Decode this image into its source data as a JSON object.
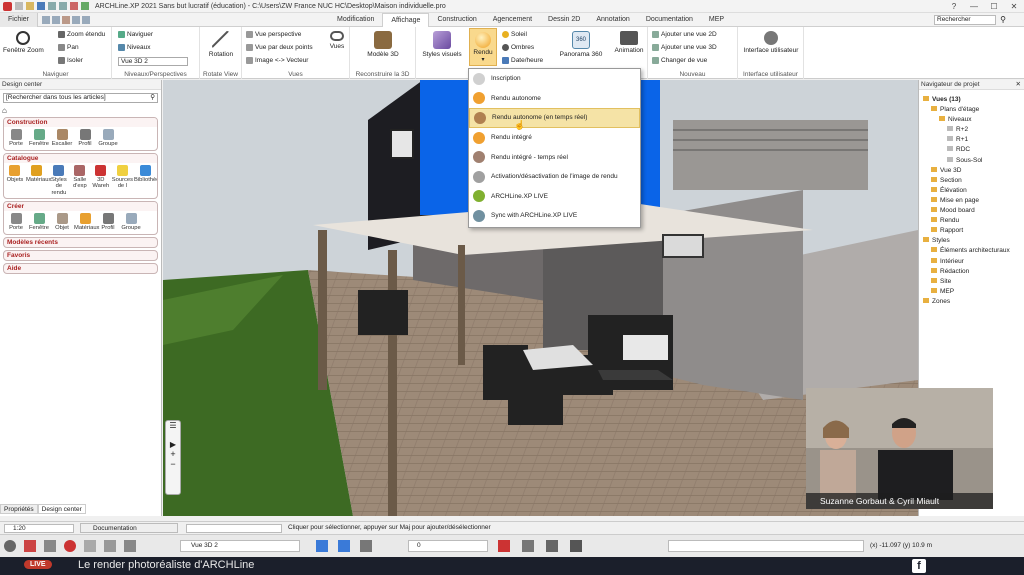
{
  "titlebar": {
    "title": "ARCHLine.XP 2021  Sans but lucratif (éducation) - C:\\Users\\ZW France NUC HC\\Desktop\\Maison individuelle.pro",
    "min": "—",
    "max": "☐",
    "close": "✕",
    "help": "?"
  },
  "tabs": [
    "Fichier",
    "Modification",
    "Affichage",
    "Construction",
    "Agencement",
    "Dessin 2D",
    "Annotation",
    "Documentation",
    "MEP"
  ],
  "search_placeholder": "Rechercher",
  "ribbon": {
    "fenetre_zoom": "Fenêtre Zoom",
    "zoom_etendu": "Zoom étendu",
    "pan": "Pan",
    "isoler": "Isoler",
    "naviguer_group": "Naviguer",
    "naviguer": "Naviguer",
    "niveaux": "Niveaux",
    "vue3d2": "Vue 3D 2",
    "niveaux_perspectives": "Niveaux/Perspectives",
    "rotation": "Rotation",
    "rotate_view": "Rotate View",
    "vue_perspective": "Vue perspective",
    "vue_deux_points": "Vue par deux points",
    "image_vecteur": "Image <-> Vecteur",
    "vues_btn": "Vues",
    "vues_group": "Vues",
    "modele3d": "Modèle 3D",
    "reconstruire": "Reconstruire la 3D",
    "styles_visuels": "Styles visuels",
    "rendu": "Rendu",
    "soleil": "Soleil",
    "ombres": "Ombres",
    "date_heure": "Date/heure",
    "panorama": "Panorama 360",
    "panorama_badge": "360",
    "animation": "Animation",
    "ajouter_3d": "Ajouter une vue 3D",
    "ajouter_2d": "Ajouter une vue 2D",
    "changer_vue": "Changer de vue",
    "nouveau": "Nouveau",
    "interface": "Interface utilisateur",
    "interface_group": "Interface utilisateur"
  },
  "rendu_menu": [
    {
      "label": "Inscription",
      "color": "#d0d0d0"
    },
    {
      "label": "Rendu autonome",
      "color": "#f0a030"
    },
    {
      "label": "Rendu autonome (en temps réel)",
      "color": "#b08050",
      "highlighted": true
    },
    {
      "label": "Rendu intégré",
      "color": "#f0a030"
    },
    {
      "label": "Rendu intégré - temps réel",
      "color": "#a08070"
    },
    {
      "label": "Activation/désactivation de l'image de rendu",
      "color": "#a0a0a0"
    },
    {
      "label": "ARCHLine.XP LIVE",
      "color": "#80b030"
    },
    {
      "label": "Sync with ARCHLine.XP LIVE",
      "color": "#7090a0"
    }
  ],
  "left": {
    "header": "Design center",
    "search": "[Rechercher dans tous les articles]",
    "construction": {
      "title": "Construction",
      "items": [
        "Porte",
        "Fenêtre",
        "Escalier",
        "Profil",
        "Groupe"
      ]
    },
    "catalogue": {
      "title": "Catalogue",
      "items": [
        "Objets",
        "Matériaux",
        "Styles de rendu",
        "Salle d'exp",
        "3D Wareh",
        "Sources de l",
        "Bibliothèque"
      ]
    },
    "creer": {
      "title": "Créer",
      "items": [
        "Porte",
        "Fenêtre",
        "Objet",
        "Matériaux",
        "Profil",
        "Groupe"
      ]
    },
    "collapsed": [
      "Modèles récents",
      "Favoris",
      "Aide"
    ],
    "tabs": [
      "Propriétés",
      "Design center"
    ]
  },
  "navigator": {
    "header": "Navigateur de projet",
    "tree": [
      {
        "label": "Vues (13)",
        "level": 0,
        "bold": true
      },
      {
        "label": "Plans d'étage",
        "level": 1
      },
      {
        "label": "Niveaux",
        "level": 2
      },
      {
        "label": "R+2",
        "level": 3
      },
      {
        "label": "R+1",
        "level": 3
      },
      {
        "label": "RDC",
        "level": 3
      },
      {
        "label": "Sous-Sol",
        "level": 3
      },
      {
        "label": "Vue 3D",
        "level": 1
      },
      {
        "label": "Section",
        "level": 1
      },
      {
        "label": "Élévation",
        "level": 1
      },
      {
        "label": "Mise en page",
        "level": 1
      },
      {
        "label": "Mood board",
        "level": 1
      },
      {
        "label": "Rendu",
        "level": 1
      },
      {
        "label": "Rapport",
        "level": 1
      },
      {
        "label": "Styles",
        "level": 0
      },
      {
        "label": "Éléments architecturaux",
        "level": 1
      },
      {
        "label": "Intérieur",
        "level": 1
      },
      {
        "label": "Rédaction",
        "level": 1
      },
      {
        "label": "Site",
        "level": 1
      },
      {
        "label": "MEP",
        "level": 1
      },
      {
        "label": "Zones",
        "level": 0
      }
    ]
  },
  "status": {
    "scale": "1:20",
    "doc": "Documentation",
    "hint": "Cliquer pour sélectionner, appuyer sur Maj pour ajouter/désélectionner",
    "coords": "(x) -11.097  (y) 10.9 m",
    "view": "Vue 3D 2",
    "value": "0"
  },
  "webcam": {
    "names": "Suzanne Gorbaut & Cyril Miault"
  },
  "banner": {
    "live": "LIVE",
    "text": "Le render photoréaliste d'ARCHLine",
    "fb": "f"
  }
}
